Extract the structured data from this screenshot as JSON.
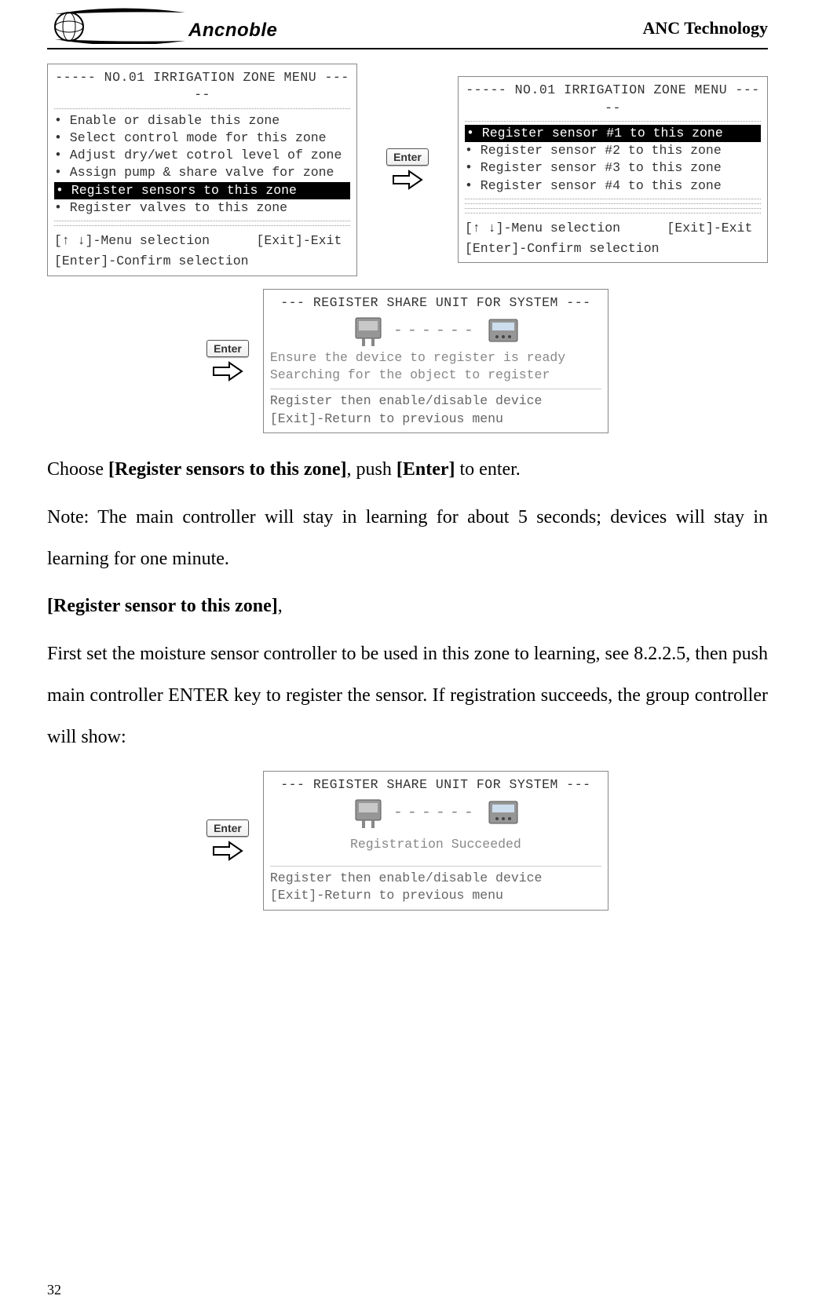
{
  "header": {
    "brand": "Ancnoble",
    "right": "ANC Technology"
  },
  "screenA": {
    "title": "----- NO.01 IRRIGATION ZONE MENU -----",
    "items": [
      "• Enable or disable this zone",
      "• Select control mode for this zone",
      "• Adjust dry/wet cotrol level of zone",
      "• Assign pump & share valve for zone",
      "• Register sensors to this zone",
      "• Register valves to this zone"
    ],
    "selectedIndex": 4,
    "foot1": "[↑ ↓]-Menu selection      [Exit]-Exit",
    "foot2": "[Enter]-Confirm selection"
  },
  "screenB": {
    "title": "----- NO.01 IRRIGATION ZONE MENU -----",
    "items": [
      "• Register sensor #1 to this zone",
      "• Register sensor #2 to this zone",
      "• Register sensor #3 to this zone",
      "• Register sensor #4 to this zone"
    ],
    "selectedIndex": 0,
    "foot1": "[↑ ↓]-Menu selection      [Exit]-Exit",
    "foot2": "[Enter]-Confirm selection"
  },
  "screenC": {
    "title": "--- REGISTER SHARE UNIT FOR SYSTEM ---",
    "progress": "------",
    "line1": "Ensure the device to register is ready",
    "line2": "Searching for the object to register",
    "foot1": "Register then enable/disable device",
    "foot2": "[Exit]-Return to previous menu"
  },
  "screenD": {
    "title": "--- REGISTER SHARE UNIT FOR SYSTEM ---",
    "progress": "------",
    "line1": "Registration Succeeded",
    "foot1": "Register then enable/disable device",
    "foot2": "[Exit]-Return to previous menu"
  },
  "enterLabel": "Enter",
  "text": {
    "p1a": "Choose ",
    "p1b": "[Register sensors to this zone]",
    "p1c": ", push ",
    "p1d": "[Enter]",
    "p1e": " to enter.",
    "p2": "Note: The main controller will stay in learning for about 5 seconds; devices will stay in learning for one minute.",
    "p3a": "[Register sensor to this zone]",
    "p3b": ",",
    "p4": "First set the moisture sensor controller to be used in this zone to learning, see 8.2.2.5, then push main controller ENTER key to register the sensor. If registration succeeds, the group controller will show:"
  },
  "pageNumber": "32"
}
